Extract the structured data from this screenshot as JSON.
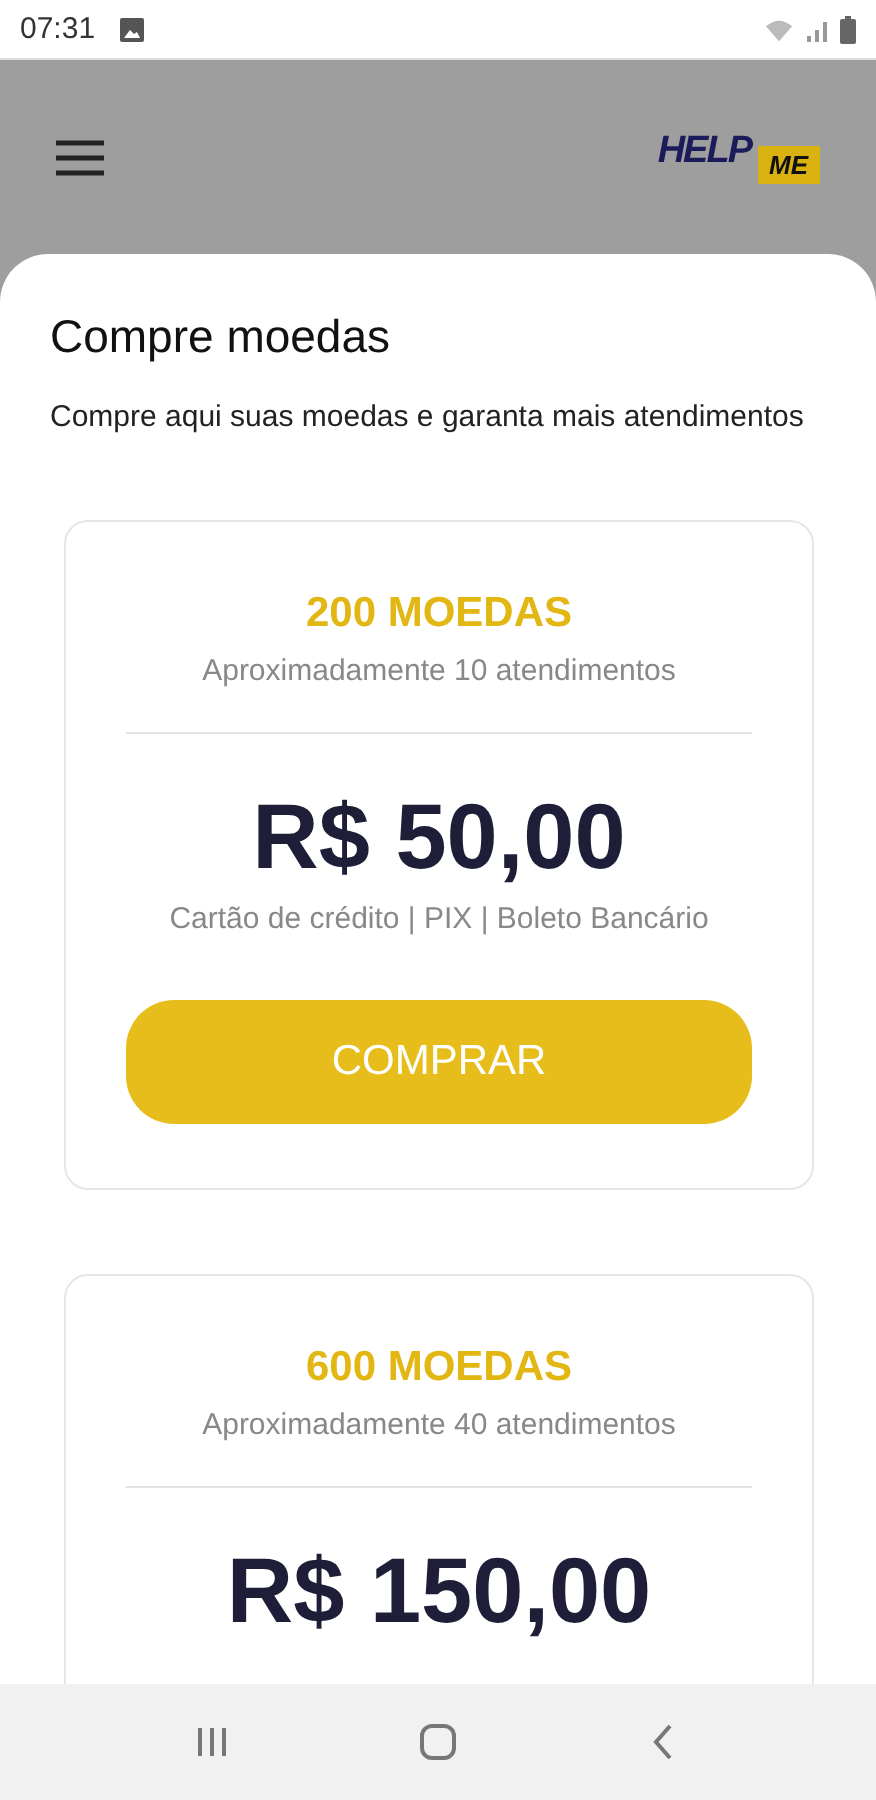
{
  "status_bar": {
    "time": "07:31"
  },
  "header": {
    "logo": {
      "part_1": "HELP",
      "part_2": "ME"
    }
  },
  "page": {
    "title": "Compre moedas",
    "subtitle": "Compre aqui suas moedas e garanta mais atendimentos"
  },
  "packages": [
    {
      "coins": "200 MOEDAS",
      "estimate": "Aproximadamente 10 atendimentos",
      "price": "R$ 50,00",
      "payment": "Cartão de crédito | PIX | Boleto Bancário",
      "button": "COMPRAR"
    },
    {
      "coins": "600 MOEDAS",
      "estimate": "Aproximadamente 40 atendimentos",
      "price": "R$ 150,00"
    }
  ]
}
